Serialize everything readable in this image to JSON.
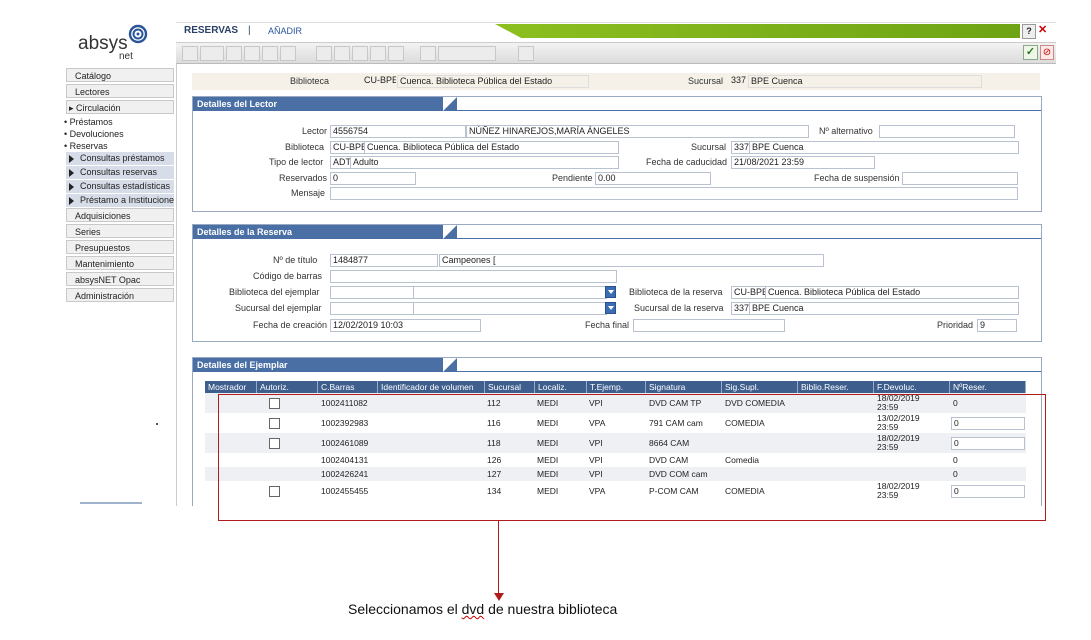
{
  "logo": {
    "brand": "absys",
    "suffix": "net"
  },
  "header": {
    "title": "RESERVAS",
    "separator": "|",
    "add_label": "AÑADIR",
    "help": "?"
  },
  "sidebar": {
    "items": [
      "Catálogo",
      "Lectores",
      "Circulación"
    ],
    "circ_subs": [
      "Préstamos",
      "Devoluciones",
      "Reservas"
    ],
    "reserva_subs": [
      "Consultas préstamos",
      "Consultas reservas",
      "Consultas estadísticas",
      "Préstamo a Instituciones"
    ],
    "items_bottom": [
      "Adquisiciones",
      "Series",
      "Presupuestos",
      "Mantenimiento",
      "absysNET Opac",
      "Administración"
    ]
  },
  "library_strip": {
    "biblioteca_label": "Biblioteca",
    "biblioteca_code": "CU-BPE",
    "biblioteca_name": "Cuenca. Biblioteca Pública del Estado",
    "sucursal_label": "Sucursal",
    "sucursal_code": "337",
    "sucursal_name": "BPE Cuenca"
  },
  "lector": {
    "section_title": "Detalles del Lector",
    "lector_label": "Lector",
    "lector_id": "4556754",
    "lector_name": "NÚÑEZ HINAREJOS,MARÍA ÁNGELES",
    "alt_label": "Nº alternativo",
    "alt_value": "",
    "biblioteca_label": "Biblioteca",
    "biblioteca_code": "CU-BPE",
    "biblioteca_name": "Cuenca. Biblioteca Pública del Estado",
    "sucursal_label": "Sucursal",
    "sucursal_code": "337",
    "sucursal_name": "BPE Cuenca",
    "tipo_label": "Tipo de lector",
    "tipo_code": "ADT",
    "tipo_name": "Adulto",
    "caducidad_label": "Fecha de caducidad",
    "caducidad_value": "21/08/2021 23:59",
    "reservados_label": "Reservados",
    "reservados_value": "0",
    "pendiente_label": "Pendiente",
    "pendiente_value": "0.00",
    "suspension_label": "Fecha de suspensión",
    "suspension_value": "",
    "mensaje_label": "Mensaje",
    "mensaje_value": ""
  },
  "reserva": {
    "section_title": "Detalles de la Reserva",
    "titulo_label": "Nº de título",
    "titulo_id": "1484877",
    "titulo_name": "Campeones [",
    "barras_label": "Código de barras",
    "barras_value": "",
    "bib_ejemplar_label": "Biblioteca del ejemplar",
    "bib_reserva_label": "Biblioteca de la reserva",
    "bib_reserva_code": "CU-BPE",
    "bib_reserva_name": "Cuenca. Biblioteca Pública del Estado",
    "suc_ejemplar_label": "Sucursal del ejemplar",
    "suc_reserva_label": "Sucursal de la reserva",
    "suc_reserva_code": "337",
    "suc_reserva_name": "BPE Cuenca",
    "creacion_label": "Fecha de creación",
    "creacion_value": "12/02/2019 10:03",
    "final_label": "Fecha final",
    "final_value": "",
    "prioridad_label": "Prioridad",
    "prioridad_value": "9"
  },
  "ejemplar": {
    "section_title": "Detalles del Ejemplar",
    "columns": [
      "Mostrador",
      "Autoriz.",
      "C.Barras",
      "Identificador de volumen",
      "Sucursal",
      "Localiz.",
      "T.Ejemp.",
      "Signatura",
      "Sig.Supl.",
      "Biblio.Reser.",
      "F.Devoluc.",
      "NºReser."
    ],
    "rows": [
      {
        "checkbox": true,
        "barras": "1002411082",
        "vol": "",
        "sucursal": "112",
        "localiz": "MEDI",
        "tejemp": "VPI",
        "signatura": "DVD CAM TP",
        "sigsupl": "DVD COMEDIA",
        "biblio": "",
        "fdev1": "18/02/2019",
        "fdev2": "23:59",
        "nres": "0",
        "nres_field": false
      },
      {
        "checkbox": true,
        "barras": "1002392983",
        "vol": "",
        "sucursal": "116",
        "localiz": "MEDI",
        "tejemp": "VPA",
        "signatura": "791 CAM cam",
        "sigsupl": "COMEDIA",
        "biblio": "",
        "fdev1": "13/02/2019",
        "fdev2": "23:59",
        "nres": "0",
        "nres_field": true
      },
      {
        "checkbox": true,
        "barras": "1002461089",
        "vol": "",
        "sucursal": "118",
        "localiz": "MEDI",
        "tejemp": "VPI",
        "signatura": "8664 CAM",
        "sigsupl": "",
        "biblio": "",
        "fdev1": "18/02/2019",
        "fdev2": "23:59",
        "nres": "0",
        "nres_field": true
      },
      {
        "checkbox": false,
        "barras": "1002404131",
        "vol": "",
        "sucursal": "126",
        "localiz": "MEDI",
        "tejemp": "VPI",
        "signatura": "DVD CAM",
        "sigsupl": "Comedia",
        "biblio": "",
        "fdev1": "",
        "fdev2": "",
        "nres": "0",
        "nres_field": false
      },
      {
        "checkbox": false,
        "barras": "1002426241",
        "vol": "",
        "sucursal": "127",
        "localiz": "MEDI",
        "tejemp": "VPI",
        "signatura": "DVD COM cam",
        "sigsupl": "",
        "biblio": "",
        "fdev1": "",
        "fdev2": "",
        "nres": "0",
        "nres_field": false
      },
      {
        "checkbox": true,
        "barras": "1002455455",
        "vol": "",
        "sucursal": "134",
        "localiz": "MEDI",
        "tejemp": "VPA",
        "signatura": "P-COM CAM",
        "sigsupl": "COMEDIA",
        "biblio": "",
        "fdev1": "18/02/2019",
        "fdev2": "23:59",
        "nres": "0",
        "nres_field": true
      }
    ]
  },
  "annotation": {
    "before": "Seleccionamos el ",
    "word": "dvd",
    "after": " de nuestra biblioteca",
    "color": "#b01c1c"
  }
}
